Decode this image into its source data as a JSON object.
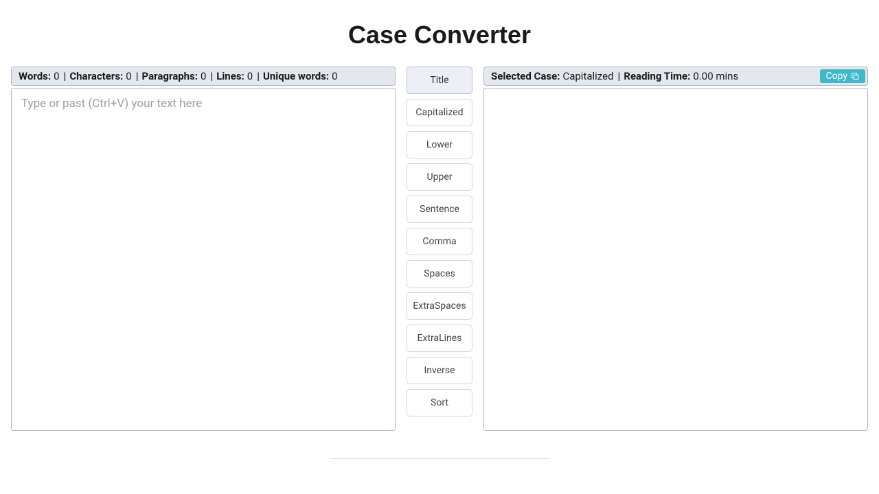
{
  "title": "Case Converter",
  "input": {
    "placeholder": "Type or past (Ctrl+V) your text here",
    "value": "",
    "stats": {
      "words_label": "Words:",
      "words_value": "0",
      "chars_label": "Characters:",
      "chars_value": "0",
      "paras_label": "Paragraphs:",
      "paras_value": "0",
      "lines_label": "Lines:",
      "lines_value": "0",
      "unique_label": "Unique words:",
      "unique_value": "0"
    }
  },
  "output": {
    "value": "",
    "selected_case_label": "Selected Case:",
    "selected_case_value": "Capitalized",
    "reading_time_label": "Reading Time:",
    "reading_time_value": "0.00 mins",
    "copy_label": "Copy"
  },
  "buttons": {
    "title": "Title",
    "capitalized": "Capitalized",
    "lower": "Lower",
    "upper": "Upper",
    "sentence": "Sentence",
    "comma": "Comma",
    "spaces": "Spaces",
    "extraspaces": "ExtraSpaces",
    "extralines": "ExtraLines",
    "inverse": "Inverse",
    "sort": "Sort"
  },
  "active_button": "title",
  "separator": "|"
}
